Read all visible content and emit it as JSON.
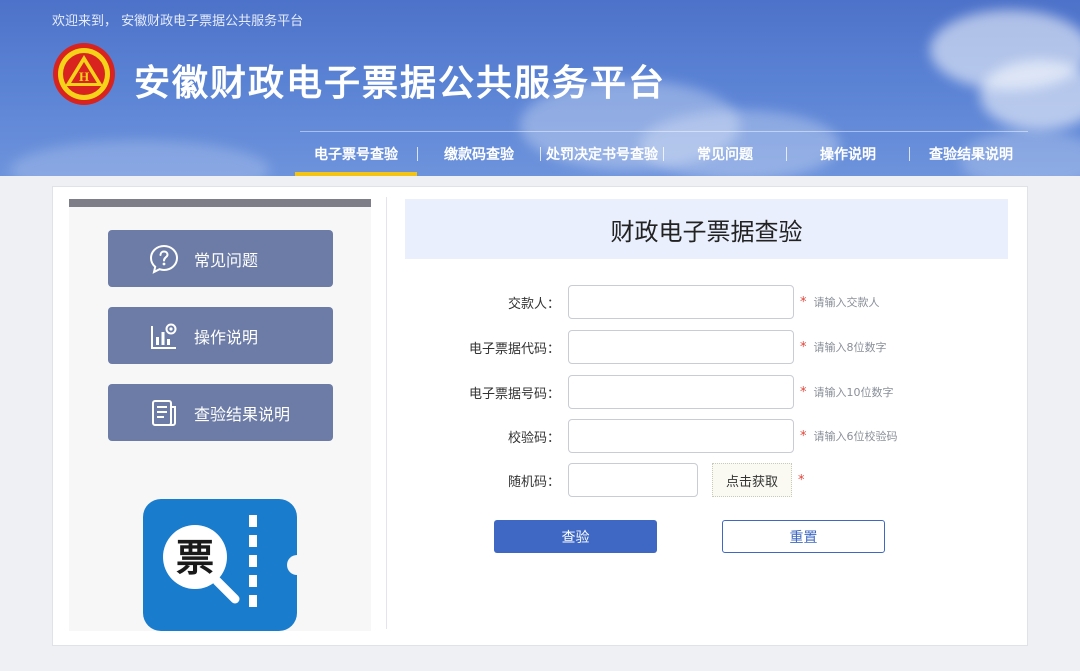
{
  "header": {
    "welcome": "欢迎来到，  安徽财政电子票据公共服务平台",
    "title": "安徽财政电子票据公共服务平台",
    "logo_char": "H"
  },
  "nav": {
    "items": [
      {
        "label": "电子票号查验",
        "active": true
      },
      {
        "label": "缴款码查验",
        "active": false
      },
      {
        "label": "处罚决定书号查验",
        "active": false
      },
      {
        "label": "常见问题",
        "active": false
      },
      {
        "label": "操作说明",
        "active": false
      },
      {
        "label": "查验结果说明",
        "active": false
      }
    ]
  },
  "sidebar": {
    "buttons": [
      {
        "label": "常见问题",
        "icon": "question-icon"
      },
      {
        "label": "操作说明",
        "icon": "chart-gear-icon"
      },
      {
        "label": "查验结果说明",
        "icon": "document-icon"
      }
    ],
    "app_icon_char": "票"
  },
  "main": {
    "title": "财政电子票据查验",
    "fields": [
      {
        "label": "交款人：",
        "hint": "请输入交款人",
        "value": ""
      },
      {
        "label": "电子票据代码：",
        "hint": "请输入8位数字",
        "value": ""
      },
      {
        "label": "电子票据号码：",
        "hint": "请输入10位数字",
        "value": ""
      },
      {
        "label": "校验码：",
        "hint": "请输入6位校验码",
        "value": ""
      }
    ],
    "captcha": {
      "label": "随机码：",
      "button": "点击获取",
      "value": ""
    },
    "required_mark": "*",
    "submit_label": "查验",
    "reset_label": "重置"
  },
  "colors": {
    "header_blue": "#5a82d4",
    "nav_active": "#f3c316",
    "side_button": "#6c7ca6",
    "primary": "#3f68c4",
    "required": "#e2453a"
  }
}
